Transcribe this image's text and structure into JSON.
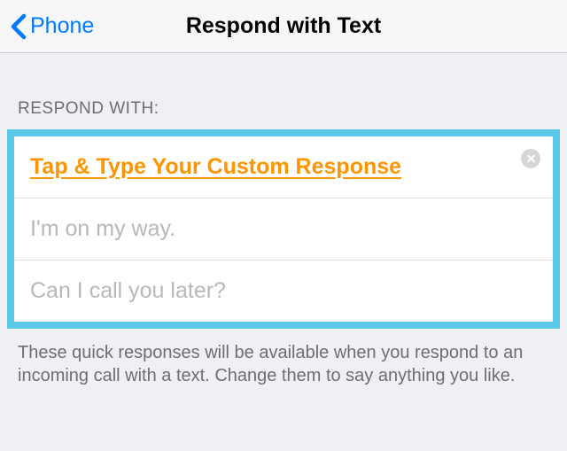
{
  "header": {
    "back_label": "Phone",
    "title": "Respond with Text"
  },
  "section": {
    "header": "RESPOND WITH:"
  },
  "responses": {
    "custom_label": "Tap & Type Your Custom Response",
    "preset1": "I'm on my way.",
    "preset2": "Can I call you later?"
  },
  "footer": {
    "text": "These quick responses will be available when you respond to an incoming call with a text. Change them to say anything you like."
  }
}
